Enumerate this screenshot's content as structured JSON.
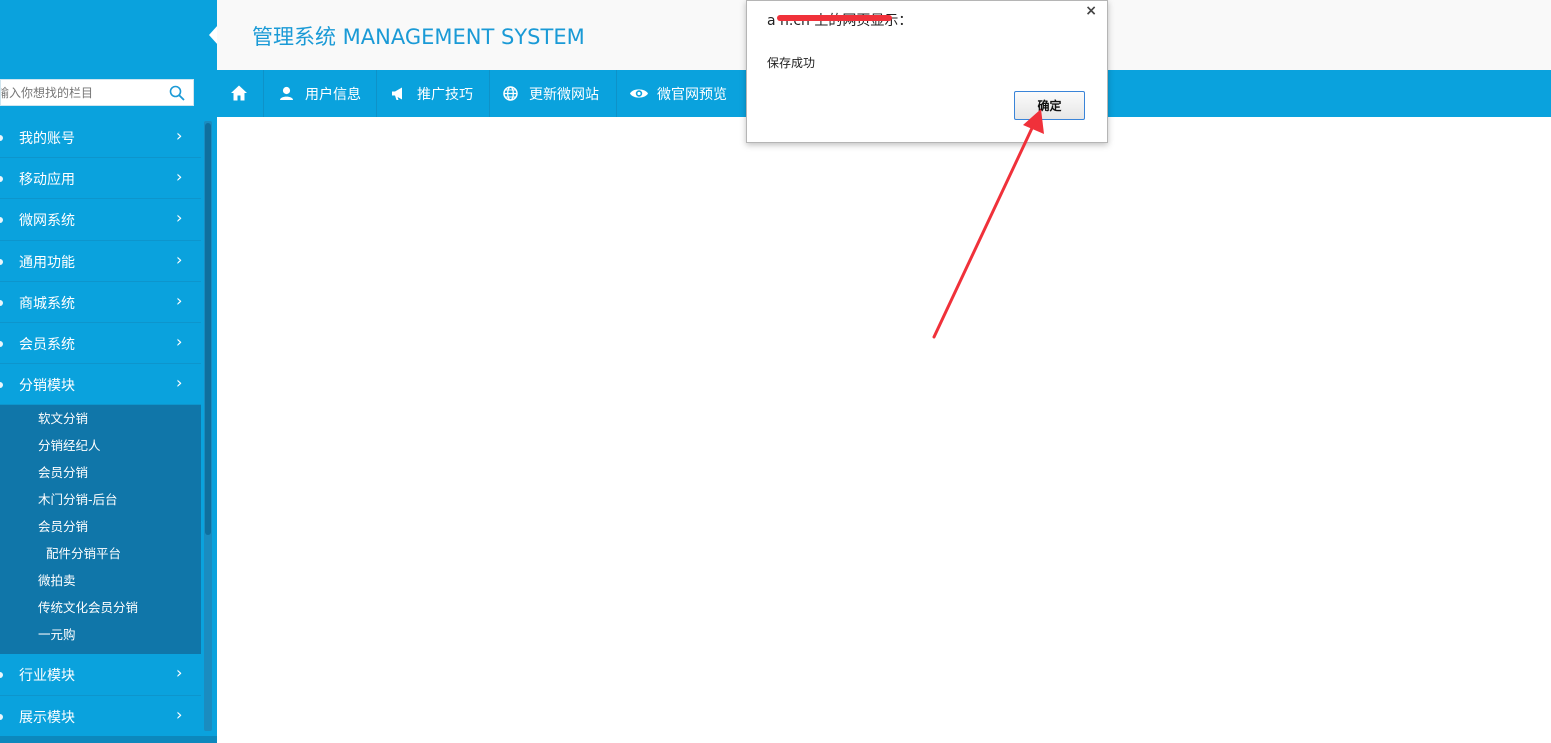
{
  "header": {
    "title": "管理系统 MANAGEMENT SYSTEM"
  },
  "search": {
    "placeholder": "输入你想找的栏目"
  },
  "sidebar": {
    "items": [
      {
        "label": "我的账号"
      },
      {
        "label": "移动应用"
      },
      {
        "label": "微网系统"
      },
      {
        "label": "通用功能"
      },
      {
        "label": "商城系统"
      },
      {
        "label": "会员系统"
      },
      {
        "label": "分销模块",
        "expanded": true
      }
    ],
    "submenu": [
      {
        "label": "软文分销"
      },
      {
        "label": "分销经纪人"
      },
      {
        "label": "会员分销"
      },
      {
        "label": "木门分销-后台"
      },
      {
        "label": "会员分销"
      },
      {
        "label": "配件分销平台",
        "indent": true
      },
      {
        "label": "微拍卖"
      },
      {
        "label": "传统文化会员分销"
      },
      {
        "label": "一元购"
      }
    ],
    "after_items": [
      {
        "label": "行业模块"
      },
      {
        "label": "展示模块"
      }
    ],
    "chevron": "›"
  },
  "nav": {
    "items": [
      {
        "label": "",
        "icon": "home-icon"
      },
      {
        "label": "用户信息",
        "icon": "user-icon"
      },
      {
        "label": "推广技巧",
        "icon": "megaphone-icon"
      },
      {
        "label": "更新微网站",
        "icon": "globe-icon"
      },
      {
        "label": "微官网预览",
        "icon": "eye-icon"
      }
    ]
  },
  "dialog": {
    "title": "a                      n.cn 上的网页显示：",
    "message": "保存成功",
    "ok_label": "确定",
    "close_label": "×"
  },
  "colors": {
    "sidebar": "#0aa2dd",
    "submenu": "#1076a9",
    "navbar": "#0aa2dd",
    "title": "#1a9ad6",
    "annotation": "#f0313a"
  }
}
